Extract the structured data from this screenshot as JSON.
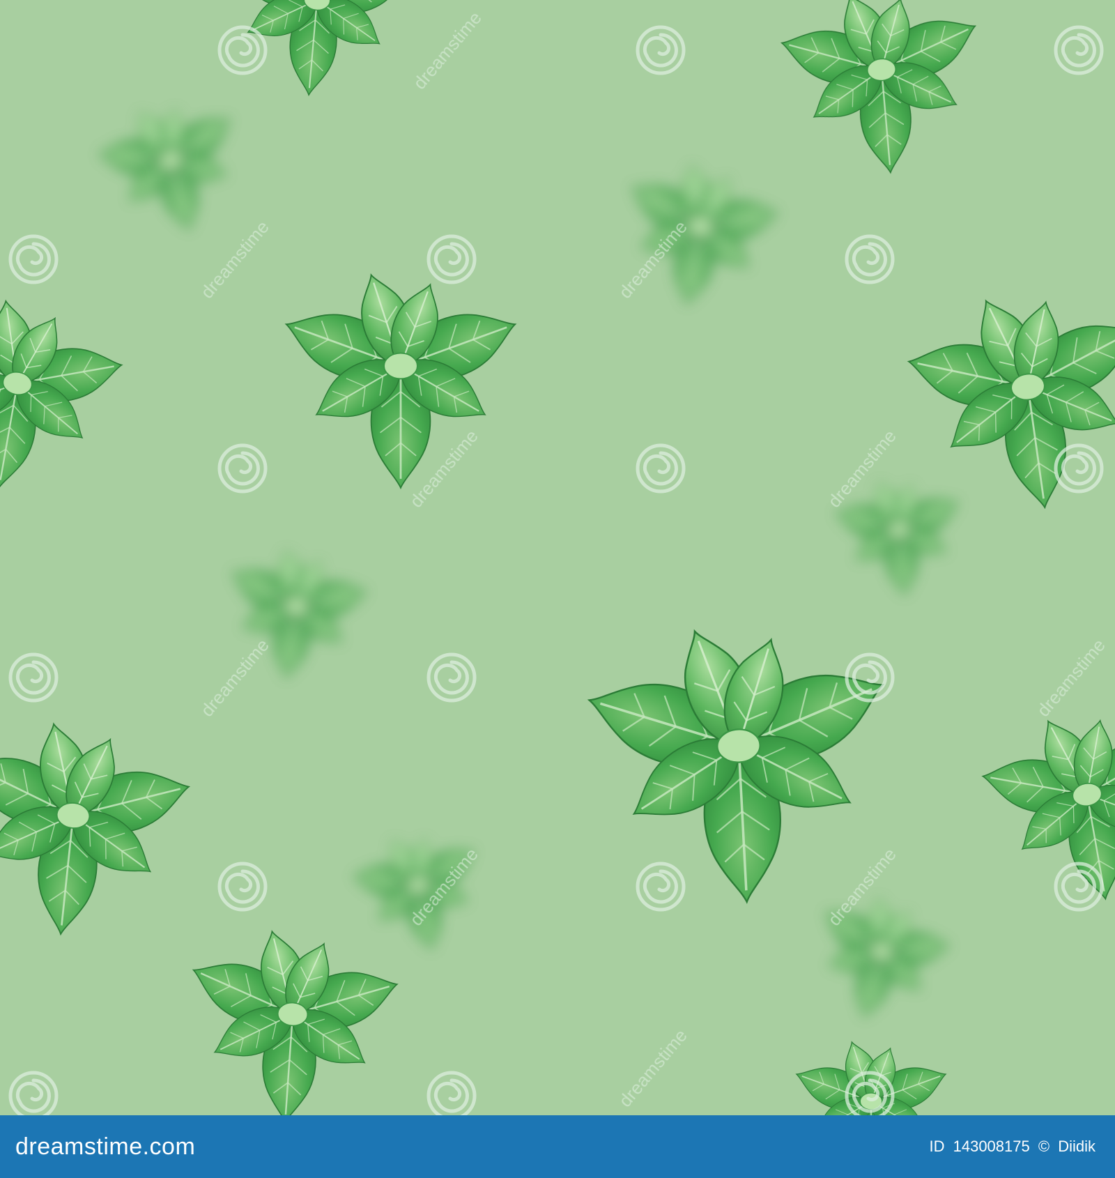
{
  "image": {
    "description_colors": {
      "background": "#a8cfa0",
      "leaf_dark": "#2f8a3c",
      "leaf_mid": "#46a94f",
      "leaf_light": "#7cc473",
      "leaf_vein": "#c7e8bf",
      "watermark": "#dceedd"
    },
    "watermark_text": "dreamstime",
    "watermark_icon": "spiral-logo-icon"
  },
  "footer": {
    "bar_color": "#1c76b4",
    "brand": "dreamstime.com",
    "id_label": "ID",
    "id_value": "143008175",
    "copyright_symbol": "©",
    "author": "Diidik"
  }
}
